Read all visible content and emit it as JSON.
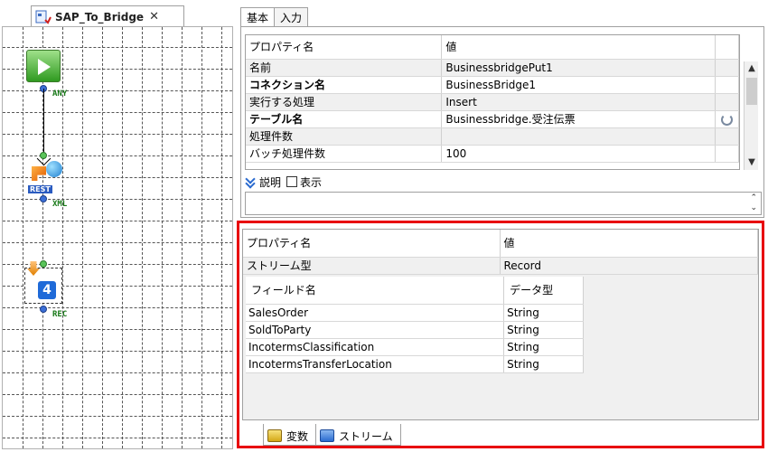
{
  "flow_tab": {
    "title": "SAP_To_Bridge",
    "close": "✕"
  },
  "flow": {
    "labels": {
      "start_out": "ANY",
      "rest_out": "XML",
      "bridge_out": "REC"
    },
    "rest_text": "REST",
    "bridge_text": "4"
  },
  "prop_tabs": {
    "basic": "基本",
    "input": "入力"
  },
  "props": {
    "header": {
      "name": "プロパティ名",
      "value": "値"
    },
    "rows": [
      {
        "name": "名前",
        "value": "BusinessbridgePut1"
      },
      {
        "name": "コネクション名",
        "value": "BusinessBridge1"
      },
      {
        "name": "実行する処理",
        "value": "Insert"
      },
      {
        "name": "テーブル名",
        "value": "Businessbridge.受注伝票"
      },
      {
        "name": "処理件数",
        "value": ""
      },
      {
        "name": "バッチ処理件数",
        "value": "100"
      }
    ]
  },
  "description": {
    "label": "説明",
    "show": "表示"
  },
  "stream": {
    "header": {
      "name": "プロパティ名",
      "value": "値"
    },
    "type_row": {
      "name": "ストリーム型",
      "value": "Record"
    },
    "fields_header": {
      "name": "フィールド名",
      "type": "データ型"
    },
    "fields": [
      {
        "name": "SalesOrder",
        "type": "String"
      },
      {
        "name": "SoldToParty",
        "type": "String"
      },
      {
        "name": "IncotermsClassification",
        "type": "String"
      },
      {
        "name": "IncotermsTransferLocation",
        "type": "String"
      }
    ]
  },
  "bottom_tabs": {
    "variables": "変数",
    "stream": "ストリーム"
  },
  "colors": {
    "highlight_border": "#e8000b",
    "port_blue": "#3b6fd6",
    "label_green": "#1a7a1a"
  }
}
